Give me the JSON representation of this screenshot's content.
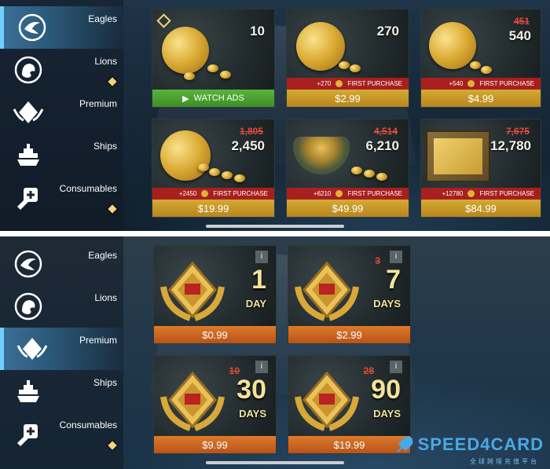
{
  "colors": {
    "gold_bar": "#c9992a",
    "green_bar": "#4aa32f",
    "orange_bar": "#cf6624",
    "strike_red": "#e04a3a",
    "promo_red": "#b41e1e",
    "active_accent": "#6fd0ff",
    "watermark_blue": "#4aa8e6"
  },
  "top": {
    "sidebar": [
      {
        "label": "Eagles",
        "icon": "eagle-icon",
        "active": true,
        "badge": false
      },
      {
        "label": "Lions",
        "icon": "lion-icon",
        "active": false,
        "badge": true
      },
      {
        "label": "Premium",
        "icon": "premium-icon",
        "active": false,
        "badge": false
      },
      {
        "label": "Ships",
        "icon": "ship-icon",
        "active": false,
        "badge": false
      },
      {
        "label": "Consumables",
        "icon": "consumables-icon",
        "active": false,
        "badge": true
      }
    ],
    "offers": [
      {
        "amount": "10",
        "old": "",
        "promo": "",
        "price": "WATCH ADS",
        "kind": "ads"
      },
      {
        "amount": "270",
        "old": "",
        "promo": "+270",
        "promo_label": "FIRST PURCHASE",
        "price": "$2.99"
      },
      {
        "amount": "540",
        "old": "451",
        "promo": "+540",
        "promo_label": "FIRST PURCHASE",
        "price": "$4.99"
      },
      {
        "amount": "2,450",
        "old": "1,805",
        "promo": "+2450",
        "promo_label": "FIRST PURCHASE",
        "price": "$19.99"
      },
      {
        "amount": "6,210",
        "old": "4,514",
        "promo": "+6210",
        "promo_label": "FIRST PURCHASE",
        "price": "$49.99"
      },
      {
        "amount": "12,780",
        "old": "7,675",
        "promo": "+12780",
        "promo_label": "FIRST PURCHASE",
        "price": "$84.99"
      }
    ]
  },
  "bottom": {
    "sidebar": [
      {
        "label": "Eagles",
        "icon": "eagle-icon",
        "active": false,
        "badge": false
      },
      {
        "label": "Lions",
        "icon": "lion-icon",
        "active": false,
        "badge": false
      },
      {
        "label": "Premium",
        "icon": "premium-icon",
        "active": true,
        "badge": false
      },
      {
        "label": "Ships",
        "icon": "ship-icon",
        "active": false,
        "badge": false
      },
      {
        "label": "Consumables",
        "icon": "consumables-icon",
        "active": false,
        "badge": true
      }
    ],
    "offers": [
      {
        "num": "1",
        "unit": "DAY",
        "old": "",
        "price": "$0.99",
        "info": "i"
      },
      {
        "num": "7",
        "unit": "DAYS",
        "old": "3",
        "price": "$2.99",
        "info": "i"
      },
      {
        "num": "30",
        "unit": "DAYS",
        "old": "10",
        "price": "$9.99",
        "info": "i"
      },
      {
        "num": "90",
        "unit": "DAYS",
        "old": "28",
        "price": "$19.99",
        "info": "i"
      }
    ]
  },
  "watermark": {
    "brand": "SPEED4CARD",
    "sub": "全球跨境充值平台"
  }
}
